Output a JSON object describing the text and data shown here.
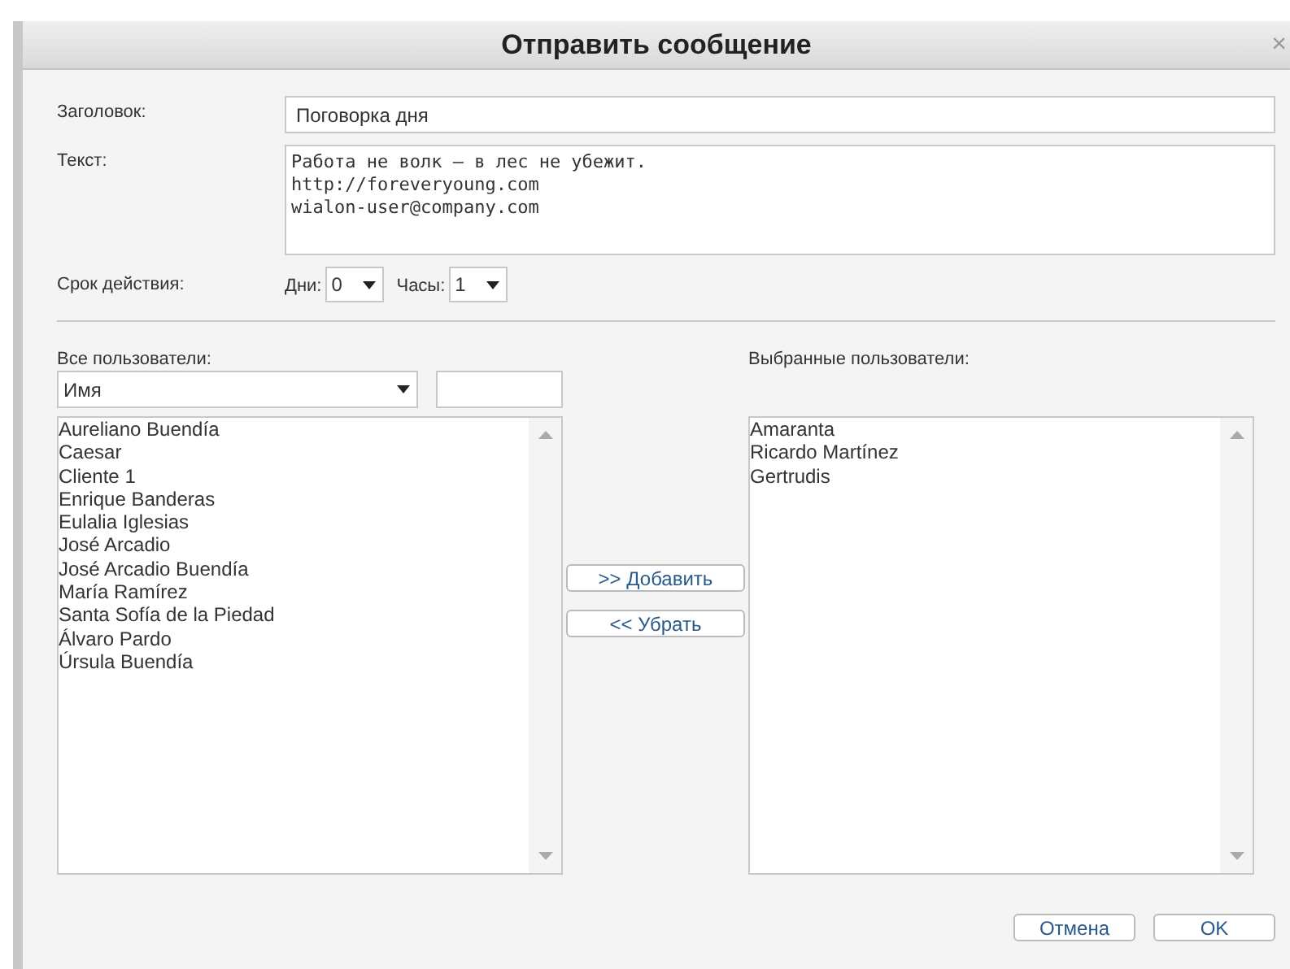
{
  "dialog": {
    "title": "Отправить сообщение",
    "close": "×"
  },
  "form": {
    "title_label": "Заголовок:",
    "title_value": "Поговорка дня",
    "text_label": "Текст:",
    "text_value": "Работа не волк — в лес не убежит.\nhttp://foreveryoung.com\nwialon-user@company.com",
    "expiry_label": "Срок действия:",
    "days_label": "Дни:",
    "days_value": "0",
    "hours_label": "Часы:",
    "hours_value": "1"
  },
  "all_users": {
    "label": "Все пользователи:",
    "filter_by": "Имя",
    "items": [
      "Aureliano Buendía",
      "Caesar",
      "Cliente 1",
      "Enrique Banderas",
      "Eulalia Iglesias",
      "José Arcadio",
      "José Arcadio Buendía",
      "María Ramírez",
      "Santa Sofía de la Piedad",
      "Álvaro Pardo",
      "Úrsula Buendía"
    ]
  },
  "transfer_buttons": [
    ">> Добавить",
    "<< Убрать"
  ],
  "selected_users": {
    "label": "Выбранные пользователи:",
    "items": [
      "Amaranta",
      "Ricardo Martínez",
      "Gertrudis"
    ]
  },
  "footer_buttons": [
    "Отмена",
    "OK"
  ]
}
